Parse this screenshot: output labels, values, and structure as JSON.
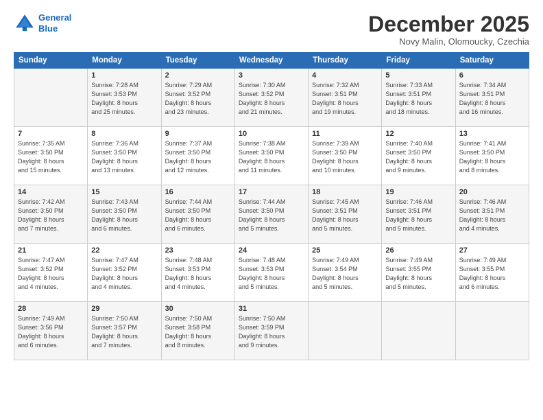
{
  "logo": {
    "line1": "General",
    "line2": "Blue"
  },
  "title": "December 2025",
  "subtitle": "Novy Malin, Olomoucky, Czechia",
  "days_of_week": [
    "Sunday",
    "Monday",
    "Tuesday",
    "Wednesday",
    "Thursday",
    "Friday",
    "Saturday"
  ],
  "weeks": [
    [
      {
        "day": "",
        "info": ""
      },
      {
        "day": "1",
        "info": "Sunrise: 7:28 AM\nSunset: 3:53 PM\nDaylight: 8 hours\nand 25 minutes."
      },
      {
        "day": "2",
        "info": "Sunrise: 7:29 AM\nSunset: 3:52 PM\nDaylight: 8 hours\nand 23 minutes."
      },
      {
        "day": "3",
        "info": "Sunrise: 7:30 AM\nSunset: 3:52 PM\nDaylight: 8 hours\nand 21 minutes."
      },
      {
        "day": "4",
        "info": "Sunrise: 7:32 AM\nSunset: 3:51 PM\nDaylight: 8 hours\nand 19 minutes."
      },
      {
        "day": "5",
        "info": "Sunrise: 7:33 AM\nSunset: 3:51 PM\nDaylight: 8 hours\nand 18 minutes."
      },
      {
        "day": "6",
        "info": "Sunrise: 7:34 AM\nSunset: 3:51 PM\nDaylight: 8 hours\nand 16 minutes."
      }
    ],
    [
      {
        "day": "7",
        "info": "Sunrise: 7:35 AM\nSunset: 3:50 PM\nDaylight: 8 hours\nand 15 minutes."
      },
      {
        "day": "8",
        "info": "Sunrise: 7:36 AM\nSunset: 3:50 PM\nDaylight: 8 hours\nand 13 minutes."
      },
      {
        "day": "9",
        "info": "Sunrise: 7:37 AM\nSunset: 3:50 PM\nDaylight: 8 hours\nand 12 minutes."
      },
      {
        "day": "10",
        "info": "Sunrise: 7:38 AM\nSunset: 3:50 PM\nDaylight: 8 hours\nand 11 minutes."
      },
      {
        "day": "11",
        "info": "Sunrise: 7:39 AM\nSunset: 3:50 PM\nDaylight: 8 hours\nand 10 minutes."
      },
      {
        "day": "12",
        "info": "Sunrise: 7:40 AM\nSunset: 3:50 PM\nDaylight: 8 hours\nand 9 minutes."
      },
      {
        "day": "13",
        "info": "Sunrise: 7:41 AM\nSunset: 3:50 PM\nDaylight: 8 hours\nand 8 minutes."
      }
    ],
    [
      {
        "day": "14",
        "info": "Sunrise: 7:42 AM\nSunset: 3:50 PM\nDaylight: 8 hours\nand 7 minutes."
      },
      {
        "day": "15",
        "info": "Sunrise: 7:43 AM\nSunset: 3:50 PM\nDaylight: 8 hours\nand 6 minutes."
      },
      {
        "day": "16",
        "info": "Sunrise: 7:44 AM\nSunset: 3:50 PM\nDaylight: 8 hours\nand 6 minutes."
      },
      {
        "day": "17",
        "info": "Sunrise: 7:44 AM\nSunset: 3:50 PM\nDaylight: 8 hours\nand 5 minutes."
      },
      {
        "day": "18",
        "info": "Sunrise: 7:45 AM\nSunset: 3:51 PM\nDaylight: 8 hours\nand 5 minutes."
      },
      {
        "day": "19",
        "info": "Sunrise: 7:46 AM\nSunset: 3:51 PM\nDaylight: 8 hours\nand 5 minutes."
      },
      {
        "day": "20",
        "info": "Sunrise: 7:46 AM\nSunset: 3:51 PM\nDaylight: 8 hours\nand 4 minutes."
      }
    ],
    [
      {
        "day": "21",
        "info": "Sunrise: 7:47 AM\nSunset: 3:52 PM\nDaylight: 8 hours\nand 4 minutes."
      },
      {
        "day": "22",
        "info": "Sunrise: 7:47 AM\nSunset: 3:52 PM\nDaylight: 8 hours\nand 4 minutes."
      },
      {
        "day": "23",
        "info": "Sunrise: 7:48 AM\nSunset: 3:53 PM\nDaylight: 8 hours\nand 4 minutes."
      },
      {
        "day": "24",
        "info": "Sunrise: 7:48 AM\nSunset: 3:53 PM\nDaylight: 8 hours\nand 5 minutes."
      },
      {
        "day": "25",
        "info": "Sunrise: 7:49 AM\nSunset: 3:54 PM\nDaylight: 8 hours\nand 5 minutes."
      },
      {
        "day": "26",
        "info": "Sunrise: 7:49 AM\nSunset: 3:55 PM\nDaylight: 8 hours\nand 5 minutes."
      },
      {
        "day": "27",
        "info": "Sunrise: 7:49 AM\nSunset: 3:55 PM\nDaylight: 8 hours\nand 6 minutes."
      }
    ],
    [
      {
        "day": "28",
        "info": "Sunrise: 7:49 AM\nSunset: 3:56 PM\nDaylight: 8 hours\nand 6 minutes."
      },
      {
        "day": "29",
        "info": "Sunrise: 7:50 AM\nSunset: 3:57 PM\nDaylight: 8 hours\nand 7 minutes."
      },
      {
        "day": "30",
        "info": "Sunrise: 7:50 AM\nSunset: 3:58 PM\nDaylight: 8 hours\nand 8 minutes."
      },
      {
        "day": "31",
        "info": "Sunrise: 7:50 AM\nSunset: 3:59 PM\nDaylight: 8 hours\nand 9 minutes."
      },
      {
        "day": "",
        "info": ""
      },
      {
        "day": "",
        "info": ""
      },
      {
        "day": "",
        "info": ""
      }
    ]
  ]
}
